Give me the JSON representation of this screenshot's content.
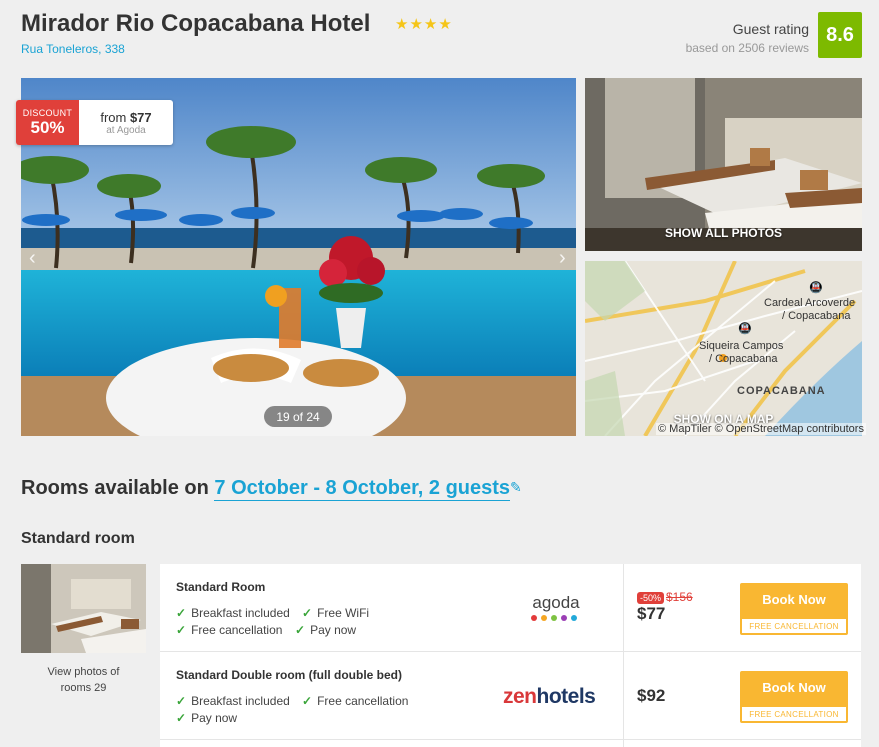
{
  "hotel": {
    "name": "Mirador Rio Copacabana Hotel",
    "stars": "★★★★",
    "address": "Rua Toneleros, 338"
  },
  "rating": {
    "label": "Guest rating",
    "reviews": "based on 2506 reviews",
    "score": "8.6",
    "color": "#7dba00"
  },
  "gallery": {
    "discount_label": "DISCOUNT",
    "discount_pct": "50%",
    "from_text": "from",
    "from_price": "$77",
    "at_text": "at Agoda",
    "counter": "19 of 24",
    "show_all": "SHOW ALL PHOTOS"
  },
  "map": {
    "label_cardeal": "Cardeal Arcoverde / Copacabana",
    "label_cardeal_1": "Cardeal Arcoverde",
    "label_cardeal_2": "/ Copacabana",
    "label_siqueira_1": "Siqueira Campos",
    "label_siqueira_2": "/ Copacabana",
    "district": "COPACABANA",
    "show_map": "SHOW ON A MAP",
    "attribution": "© MapTiler © OpenStreetMap contributors"
  },
  "rooms": {
    "heading_prefix": "Rooms available on",
    "dates": "7 October - 8 October, 2 guests",
    "edit_icon": "pencil-icon"
  },
  "room_type": {
    "title": "Standard room",
    "view_photos_1": "View photos of",
    "view_photos_2": "rooms 29"
  },
  "offers": [
    {
      "name": "Standard Room",
      "features": [
        "Breakfast included",
        "Free WiFi",
        "Free cancellation",
        "Pay now"
      ],
      "provider": "agoda",
      "discount_badge": "-50%",
      "old_price": "$156",
      "price": "$77",
      "book_label": "Book Now",
      "book_sub": "FREE CANCELLATION"
    },
    {
      "name": "Standard Double room (full double bed)",
      "features": [
        "Breakfast included",
        "Free cancellation",
        "Pay now"
      ],
      "provider": "zenhotels",
      "price": "$92",
      "book_label": "Book Now",
      "book_sub": "FREE CANCELLATION"
    }
  ],
  "colors": {
    "accent": "#1aa3d4",
    "book": "#f9b732",
    "discount": "#e0403a",
    "check": "#3aa53a"
  }
}
